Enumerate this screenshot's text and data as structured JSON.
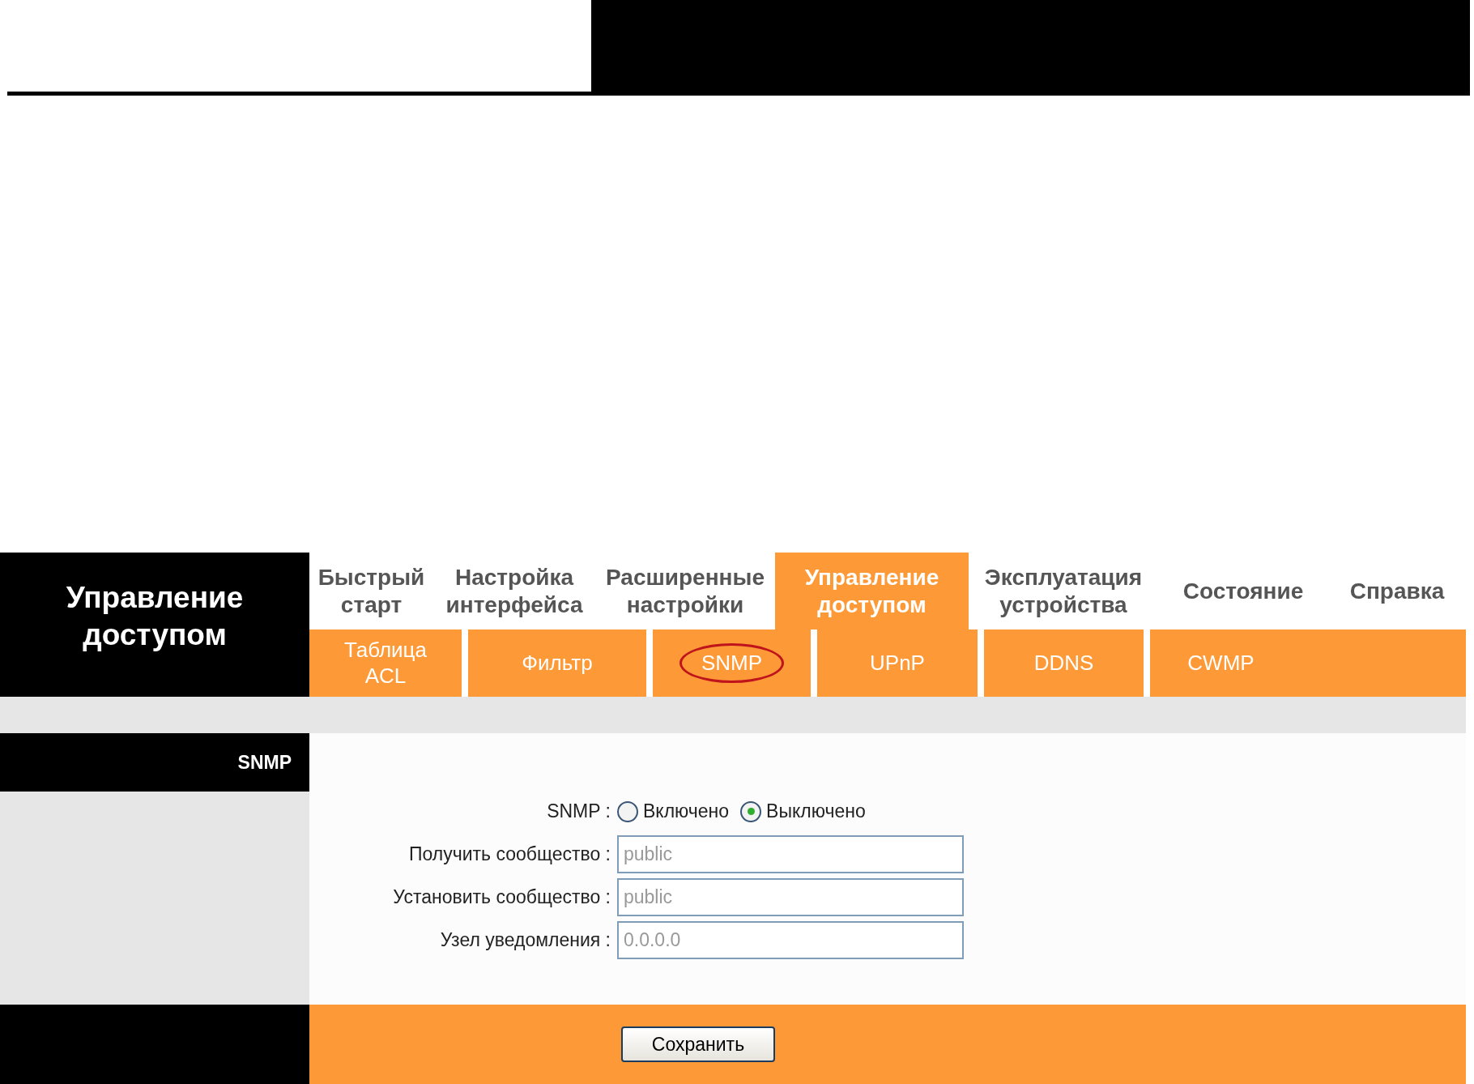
{
  "section_title": "Управление доступом",
  "main_tabs": [
    {
      "label": "Быстрый старт",
      "selected": false
    },
    {
      "label": "Настройка интерфейса",
      "selected": false
    },
    {
      "label": "Расширенные настройки",
      "selected": false
    },
    {
      "label": "Управление доступом",
      "selected": true
    },
    {
      "label": "Эксплуатация устройства",
      "selected": false
    },
    {
      "label": "Состояние",
      "selected": false
    },
    {
      "label": "Справка",
      "selected": false
    }
  ],
  "sub_tabs": [
    {
      "label": "Таблица ACL",
      "circled": false
    },
    {
      "label": "Фильтр",
      "circled": false
    },
    {
      "label": "SNMP",
      "circled": true
    },
    {
      "label": "UPnP",
      "circled": false
    },
    {
      "label": "DDNS",
      "circled": false
    },
    {
      "label": "CWMP",
      "circled": false
    }
  ],
  "panel_label": "SNMP",
  "snmp": {
    "label": "SNMP :",
    "options": [
      {
        "label": "Включено",
        "selected": false
      },
      {
        "label": "Выключено",
        "selected": true
      }
    ]
  },
  "fields": [
    {
      "label": "Получить сообщество :",
      "value": "public",
      "disabled": true
    },
    {
      "label": "Установить сообщество :",
      "value": "public",
      "disabled": true
    },
    {
      "label": "Узел уведомления :",
      "value": "0.0.0.0",
      "disabled": true
    }
  ],
  "save_button": "Сохранить"
}
